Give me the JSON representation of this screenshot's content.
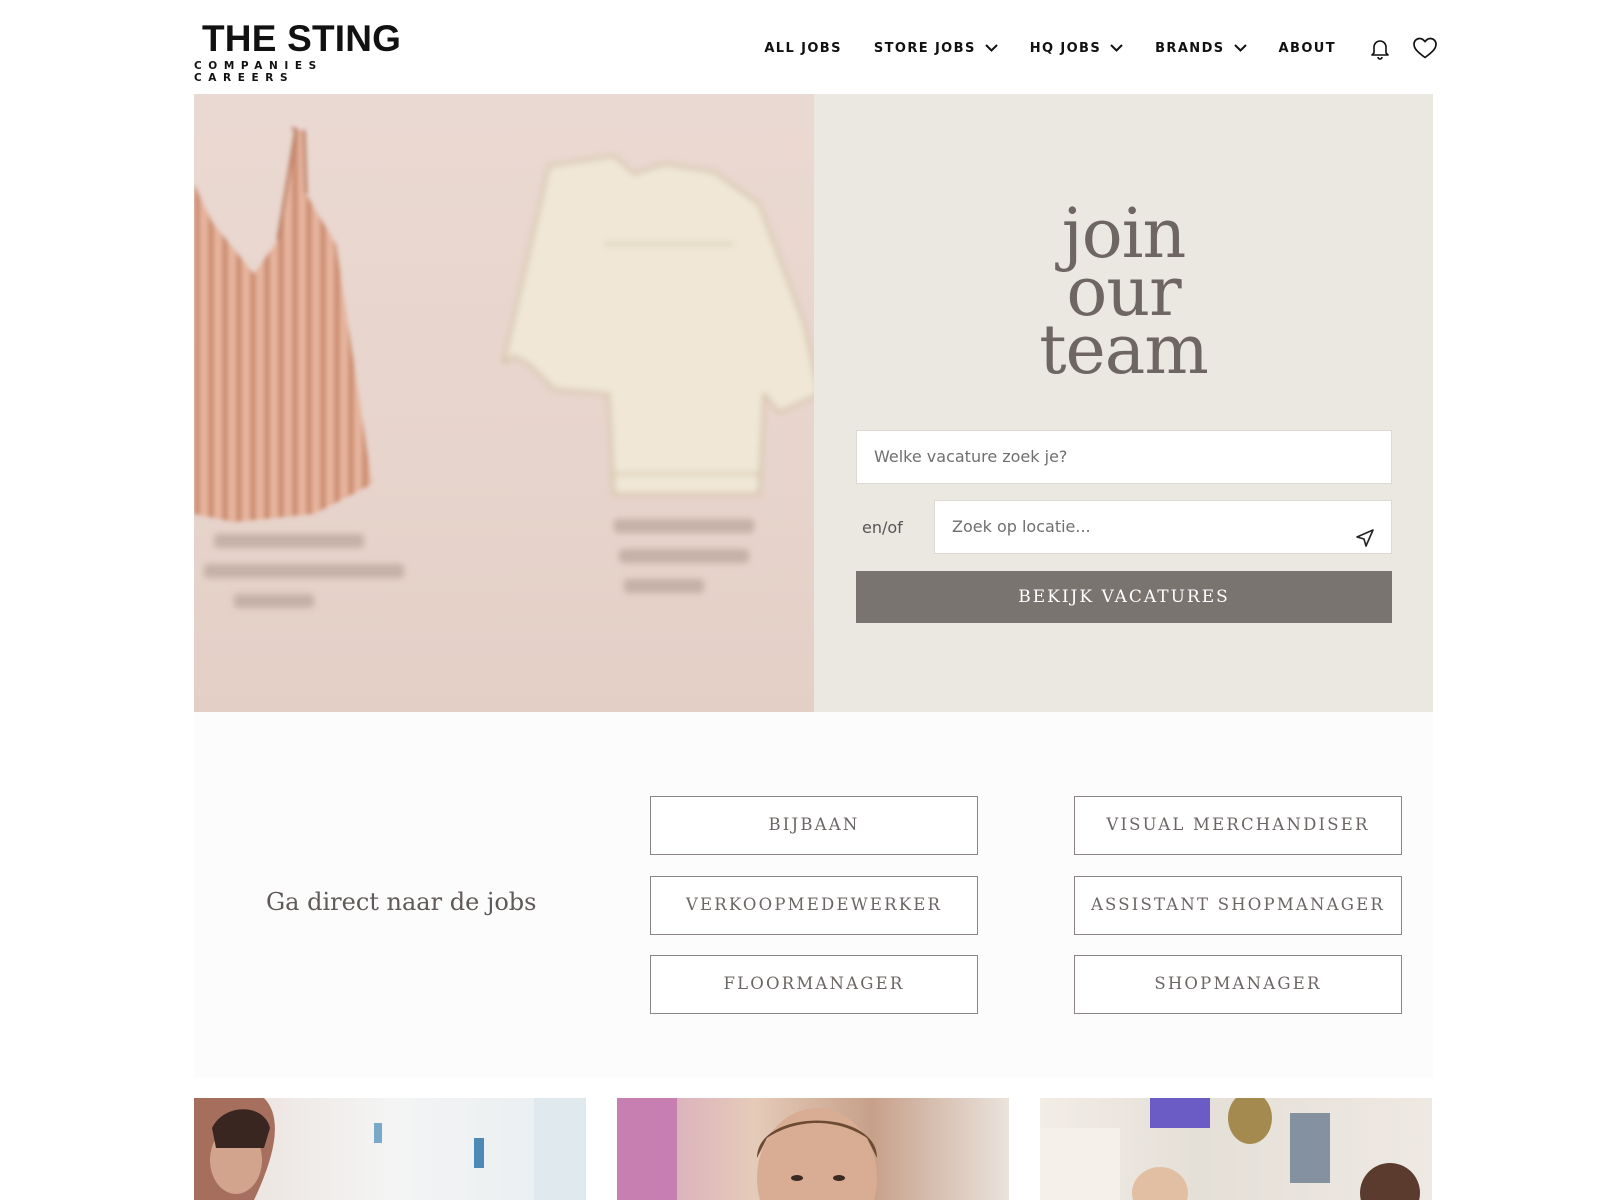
{
  "header": {
    "logo_main": "THE STING",
    "logo_sub": "COMPANIES CAREERS",
    "nav": [
      {
        "label": "ALL JOBS"
      },
      {
        "label": "STORE JOBS"
      },
      {
        "label": "HQ JOBS"
      },
      {
        "label": "BRANDS"
      },
      {
        "label": "ABOUT"
      }
    ],
    "icons": [
      "bell-icon",
      "heart-icon",
      "chevron-down-icon"
    ]
  },
  "hero": {
    "title_lines": [
      "join",
      "our",
      "team"
    ],
    "search_placeholder": "Welke vacature zoek je?",
    "connector": "en/of",
    "location_placeholder": "Zoek op locatie...",
    "location_icon": "navigation-arrow-icon",
    "button_label": "BEKIJK VACATURES"
  },
  "quick_links": {
    "label": "Ga direct naar de jobs",
    "jobs": [
      {
        "label": "BIJBAAN"
      },
      {
        "label": "VISUAL MERCHANDISER"
      },
      {
        "label": "VERKOOPMEDEWERKER"
      },
      {
        "label": "ASSISTANT SHOPMANAGER"
      },
      {
        "label": "FLOORMANAGER"
      },
      {
        "label": "SHOPMANAGER"
      }
    ]
  },
  "colors": {
    "hero_panel": "#ebe8e2",
    "button_bg": "#7a7471",
    "title_text": "#6e6663"
  }
}
